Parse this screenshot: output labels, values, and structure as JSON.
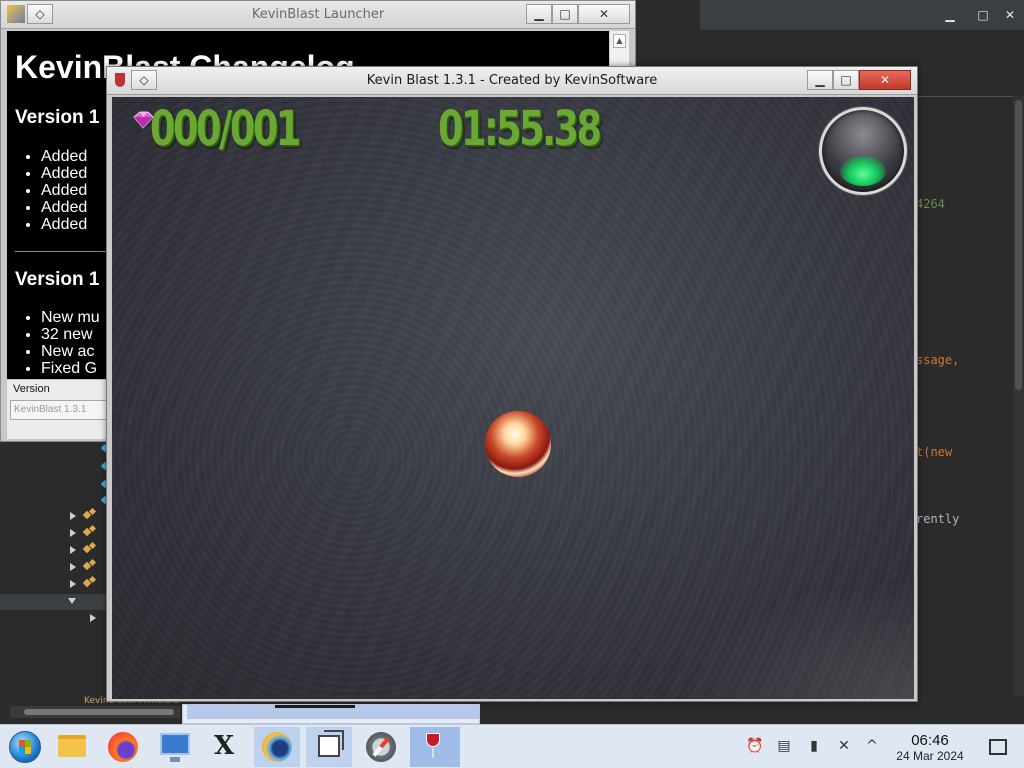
{
  "ide": {
    "window_controls": [
      "▁",
      "□",
      "✕"
    ],
    "code_lines": [
      {
        "text": "4264",
        "color": "#6a8759"
      },
      {
        "text": "ssage,",
        "color": "#cc7832"
      },
      {
        "text": "t(new",
        "color": "#cc7832",
        "extra": "new",
        "extra_color": "#6897bb"
      },
      {
        "text": "rently",
        "color": "#a9b7c6"
      }
    ],
    "status_line": "KevinBlast.AnimalBla"
  },
  "launcher": {
    "title": "KevinBlast Launcher",
    "changelog_title": "KevinBlast Changelog",
    "sections": [
      {
        "heading": "Version 1",
        "items": [
          "Added",
          "Added",
          "Added",
          "Added",
          "Added"
        ]
      },
      {
        "heading": "Version 1",
        "items": [
          "New mu",
          "32 new",
          "New ac",
          "Fixed G"
        ]
      }
    ],
    "version_label": "Version",
    "version_value": "KevinBlast 1.3.1"
  },
  "game": {
    "title": "Kevin Blast 1.3.1 - Created by KevinSoftware",
    "gem_counter": "000/001",
    "timer": "01:55.38",
    "status_light": "green",
    "colors": {
      "hud_green": "#6aa833",
      "hud_shadow": "#2f5a14",
      "orb_glow": "#14c35a"
    }
  },
  "taskbar": {
    "apps": [
      {
        "name": "start-menu-icon"
      },
      {
        "name": "file-manager-icon"
      },
      {
        "name": "firefox-icon"
      },
      {
        "name": "remote-desktop-icon"
      },
      {
        "name": "x-app-icon"
      },
      {
        "name": "sun-globe-icon"
      },
      {
        "name": "window-switcher-icon"
      },
      {
        "name": "compass-icon"
      },
      {
        "name": "wine-icon"
      }
    ],
    "clock_time": "06:46",
    "clock_date": "24 Mar 2024"
  }
}
